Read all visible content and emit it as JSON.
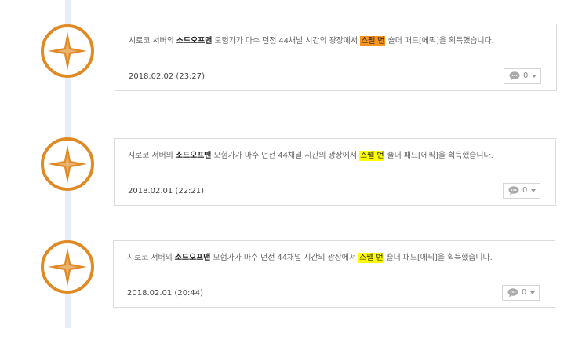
{
  "colors": {
    "emblem_orange": "#e08a25",
    "highlight_orange": "#f7941d",
    "highlight_yellow": "#ffff00",
    "timeline": "#e7eefb"
  },
  "entries": [
    {
      "text_pre": "시로코 서버의 ",
      "character": "소드오프맨",
      "text_mid": " 모험가가 마수 던전 44채널 시간의 광장에서 ",
      "item": "스펠 번",
      "item_color": "#f7941d",
      "text_post": " 숄더 패드[에픽]을 획득했습니다.",
      "date": "2018.02.02 (23:27)",
      "comment_count": "0",
      "icon": "compass-star-icon"
    },
    {
      "text_pre": "시로코 서버의 ",
      "character": "소드오프맨",
      "text_mid": " 모험가가 마수 던전 44채널 시간의 광장에서 ",
      "item": "스펠 번",
      "item_color": "#ffff00",
      "text_post": " 숄더 패드[에픽]을 획득했습니다.",
      "date": "2018.02.01 (22:21)",
      "comment_count": "0",
      "icon": "compass-star-icon"
    },
    {
      "text_pre": "시로코 서버의 ",
      "character": "소드오프맨",
      "text_mid": " 모험가가 마수 던전 44채널 시간의 광장에서 ",
      "item": "스펠 번",
      "item_color": "#ffff00",
      "text_post": " 숄더 패드[에픽]을 획득했습니다.",
      "date": "2018.02.01 (20:44)",
      "comment_count": "0",
      "icon": "compass-star-icon"
    }
  ]
}
